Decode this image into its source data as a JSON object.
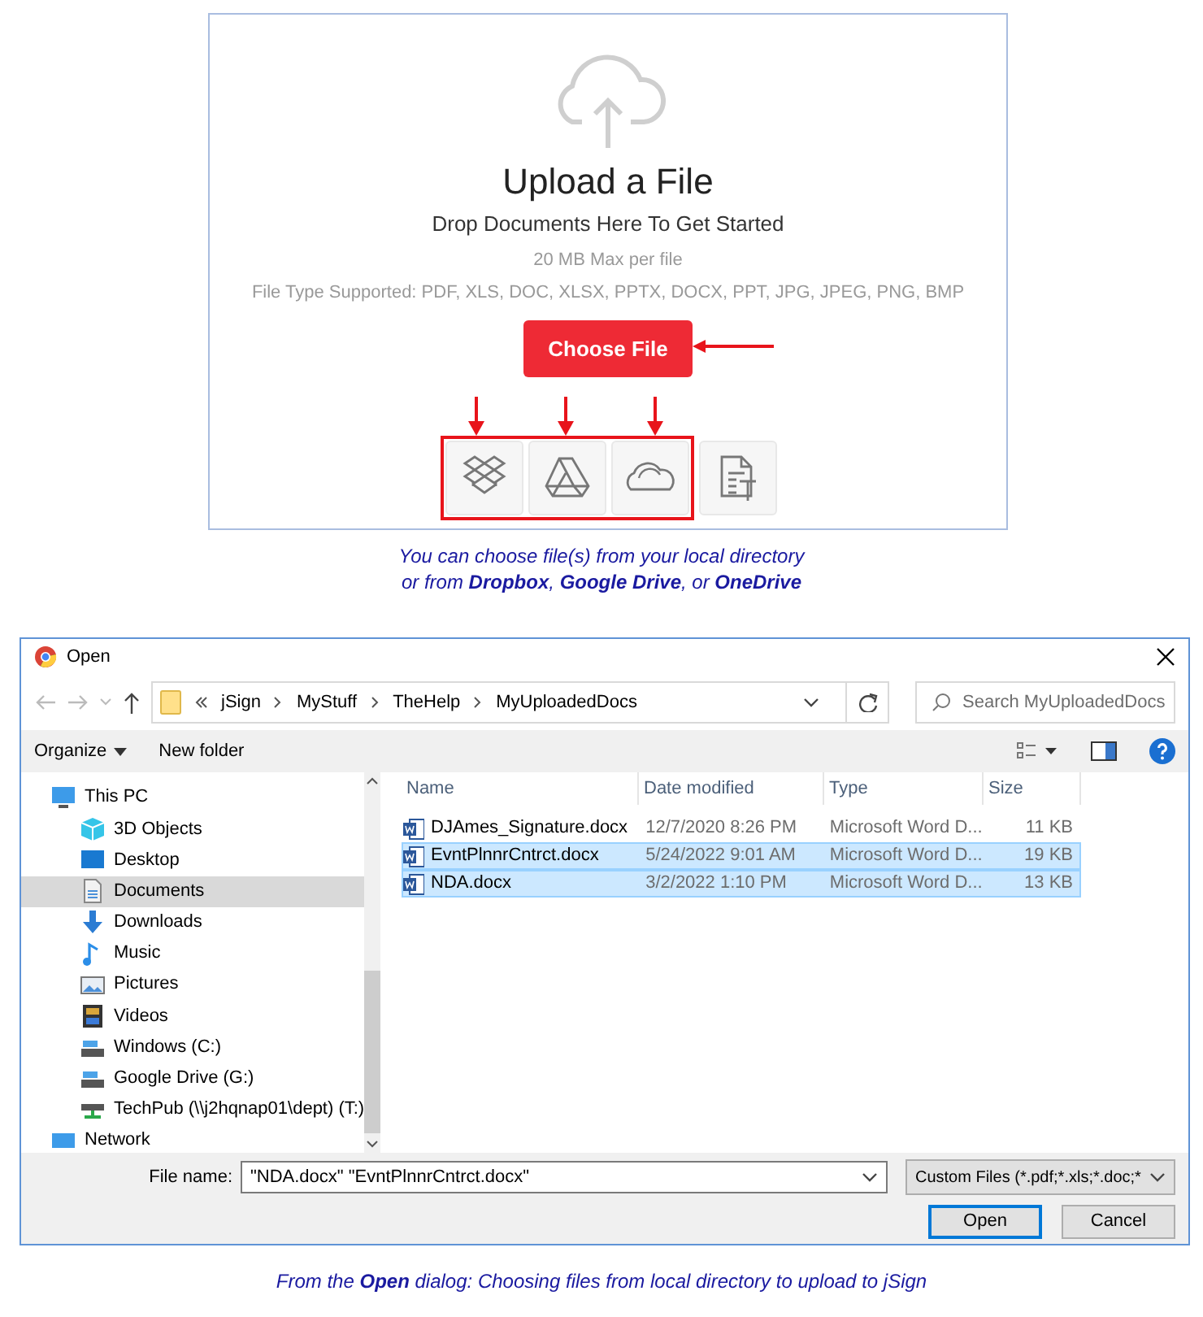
{
  "upload_panel": {
    "title": "Upload a File",
    "subtitle": "Drop Documents Here To Get Started",
    "size_limit": "20 MB Max per file",
    "file_types": "File Type Supported: PDF, XLS, DOC, XLSX, PPTX, DOCX, PPT, JPG, JPEG, PNG, BMP",
    "choose_button": "Choose File",
    "sources": [
      {
        "kind": "dropbox",
        "highlighted": true
      },
      {
        "kind": "drive",
        "highlighted": true
      },
      {
        "kind": "onedrive",
        "highlighted": true
      },
      {
        "kind": "template",
        "highlighted": false
      }
    ]
  },
  "caption_top": [
    "You can choose file(s) from your local directory",
    "or from **Dropbox**, **Google Drive**, or **OneDrive**"
  ],
  "dialog": {
    "title": "Open",
    "path": [
      "jSign",
      "MyStuff",
      "TheHelp",
      "MyUploadedDocs"
    ],
    "search": {
      "placeholder": "Search MyUploadedDocs"
    },
    "toolbar": [
      "Organize",
      "New folder"
    ],
    "nav_items": [
      {
        "label": "This PC",
        "kind": "pc",
        "selected": false,
        "children": [
          {
            "label": "3D Objects",
            "kind": "cube",
            "selected": false
          },
          {
            "label": "Desktop",
            "kind": "desktop",
            "selected": false
          },
          {
            "label": "Documents",
            "kind": "document",
            "selected": true
          },
          {
            "label": "Downloads",
            "kind": "download",
            "selected": false
          },
          {
            "label": "Music",
            "kind": "music",
            "selected": false
          },
          {
            "label": "Pictures",
            "kind": "picture",
            "selected": false
          },
          {
            "label": "Videos",
            "kind": "video",
            "selected": false
          },
          {
            "label": "Windows (C:)",
            "kind": "drive",
            "selected": false
          },
          {
            "label": "Google Drive (G:)",
            "kind": "drive",
            "selected": false
          },
          {
            "label": "TechPub (\\\\j2hqnap01\\dept) (T:)",
            "kind": "netdrive",
            "selected": false
          }
        ]
      },
      {
        "label": "Network",
        "kind": "network",
        "selected": false
      }
    ],
    "columns": [
      "Name",
      "Date modified",
      "Type",
      "Size"
    ],
    "files": [
      {
        "name": "DJAmes_Signature.docx",
        "date": "12/7/2020 8:26 PM",
        "type": "Microsoft Word D...",
        "size": "11 KB",
        "selected": false
      },
      {
        "name": "EvntPlnnrCntrct.docx",
        "date": "5/24/2022 9:01 AM",
        "type": "Microsoft Word D...",
        "size": "19 KB",
        "selected": true
      },
      {
        "name": "NDA.docx",
        "date": "3/2/2022 1:10 PM",
        "type": "Microsoft Word D...",
        "size": "13 KB",
        "selected": true
      }
    ],
    "file_name_label": "File name:",
    "file_name_value": "\"NDA.docx\" \"EvntPlnnrCntrct.docx\"",
    "file_type_filter": "Custom Files (*.pdf;*.xls;*.doc;*",
    "buttons": [
      "Open",
      "Cancel"
    ]
  },
  "caption_bottom": "From the **Open** dialog: Choosing files from local directory to upload to jSign"
}
